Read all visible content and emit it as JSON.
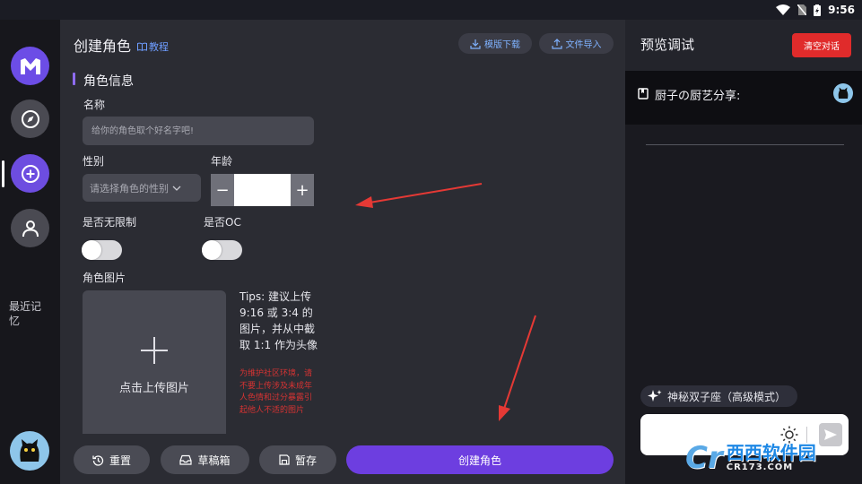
{
  "status_bar": {
    "time": "9:56"
  },
  "rail": {
    "recent_label": "最近记忆"
  },
  "header": {
    "title": "创建角色",
    "tutorial_label": "教程",
    "template_download_label": "模版下载",
    "file_import_label": "文件导入"
  },
  "form": {
    "section_title": "角色信息",
    "name_label": "名称",
    "name_placeholder": "给你的角色取个好名字吧!",
    "gender_label": "性别",
    "gender_placeholder": "请选择角色的性别",
    "age_label": "年龄",
    "age_minus": "−",
    "age_plus": "+",
    "unlimited_label": "是否无限制",
    "oc_label": "是否OC",
    "unlimited_on": false,
    "oc_on": false,
    "image_label": "角色图片",
    "upload_label": "点击上传图片",
    "tips": "Tips: 建议上传 9:16 或 3:4 的图片，并从中截取 1:1 作为头像",
    "warning": "为维护社区环境，请不要上传涉及未成年人色情和过分暴露引起他人不适的图片"
  },
  "bottom_actions": {
    "reset_label": "重置",
    "drafts_label": "草稿箱",
    "save_label": "暂存",
    "create_label": "创建角色"
  },
  "preview": {
    "title": "预览调试",
    "clear_label": "清空对话",
    "card_title": "厨子の厨艺分享:",
    "model_label": "神秘双子座（高级模式）"
  },
  "watermark": {
    "logo": "Cr",
    "name": "西西软件园",
    "domain": "CR173.COM"
  },
  "colors": {
    "accent": "#6d3ee0",
    "danger": "#e02b2b",
    "link": "#6e9dff",
    "annotation_arrow": "#e53935"
  }
}
